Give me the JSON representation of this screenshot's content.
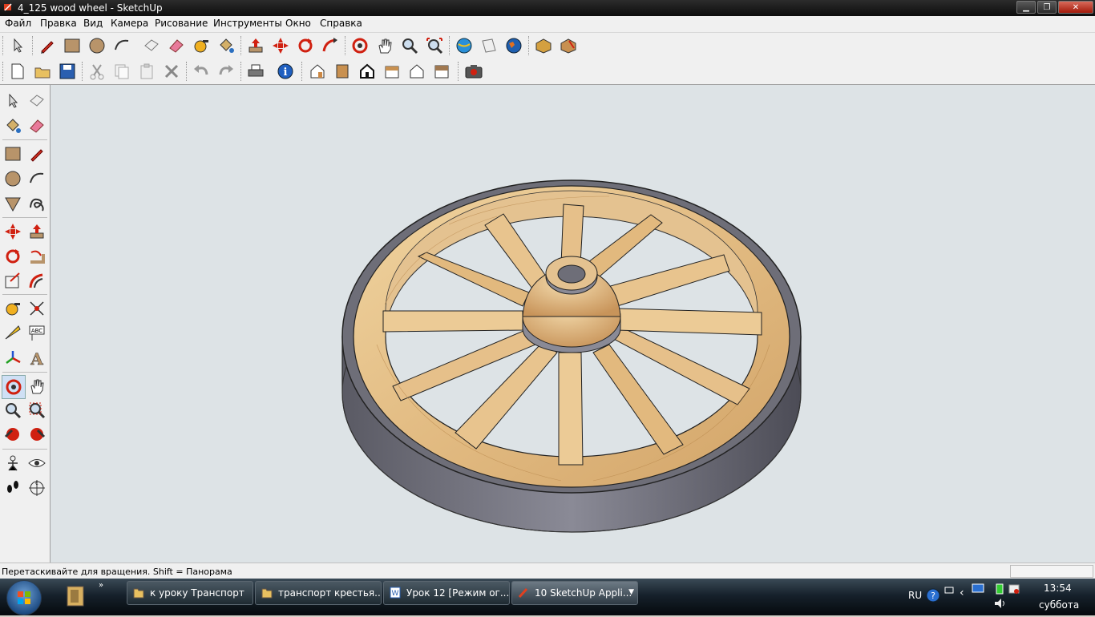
{
  "window": {
    "title": "4_125 wood wheel - SketchUp"
  },
  "menu": [
    "Файл",
    "Правка",
    "Вид",
    "Камера",
    "Рисование",
    "Инструменты",
    "Окно",
    "Справка"
  ],
  "status": {
    "text": "Перетаскивайте для вращения. Shift = Панорама"
  },
  "taskbar": {
    "tasks": [
      {
        "label": "к уроку  Транспорт",
        "icon": "folder-icon"
      },
      {
        "label": "транспорт крестья...",
        "icon": "folder-icon"
      },
      {
        "label": "Урок 12 [Режим ог...",
        "icon": "word-document-icon"
      },
      {
        "label": "10 SketchUp Appli...",
        "icon": "sketchup-icon"
      }
    ],
    "language": "RU",
    "time": "13:54",
    "day": "суббота"
  },
  "colors": {
    "viewport_bg": "#dde3e6",
    "wood": "#e8c48e",
    "iron_rim": "#6e6e78"
  },
  "scene": {
    "object": "wood wheel",
    "spoke_count": 12
  }
}
